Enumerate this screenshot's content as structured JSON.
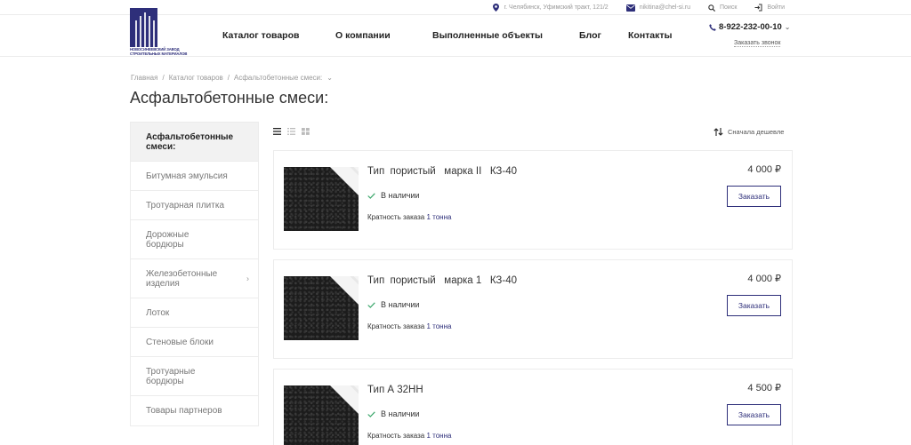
{
  "topbar": {
    "address": "г. Челябинск, Уфимский тракт, 121/2",
    "email": "nikitina@chel-si.ru",
    "search": "Поиск",
    "login": "Войти"
  },
  "logo": {
    "line1": "НОВОСИНЕЕВСКИЙ ЗАВОД",
    "line2": "СТРОИТЕЛЬНЫХ МАТЕРИАЛОВ"
  },
  "nav": [
    "Каталог товаров",
    "О компании",
    "Выполненные объекты",
    "Блог",
    "Контакты"
  ],
  "contact": {
    "phone": "8-922-232-00-10",
    "callback": "Заказать звонок"
  },
  "breadcrumbs": [
    "Главная",
    "Каталог товаров",
    "Асфальтобетонные смеси:"
  ],
  "page_title": "Асфальтобетонные смеси:",
  "sidebar": [
    {
      "label": "Асфальтобетонные смеси:",
      "active": true,
      "has_children": false
    },
    {
      "label": "Битумная эмульсия",
      "active": false,
      "has_children": false
    },
    {
      "label": "Тротуарная плитка",
      "active": false,
      "has_children": false
    },
    {
      "label": "Дорожные бордюры",
      "active": false,
      "has_children": false
    },
    {
      "label": "Железобетонные изделия",
      "active": false,
      "has_children": true
    },
    {
      "label": "Лоток",
      "active": false,
      "has_children": false
    },
    {
      "label": "Стеновые блоки",
      "active": false,
      "has_children": false
    },
    {
      "label": "Тротуарные бордюры",
      "active": false,
      "has_children": false
    },
    {
      "label": "Товары партнеров",
      "active": false,
      "has_children": false
    }
  ],
  "sort_label": "Сначала дешевле",
  "products": [
    {
      "name": "Тип  пористый   марка II   КЗ-40",
      "stock": "В наличии",
      "multiplicity_label": "Кратность заказа",
      "multiplicity_value": "1 тонна",
      "price": "4 000 ₽",
      "order_label": "Заказать"
    },
    {
      "name": "Тип  пористый   марка 1   КЗ-40",
      "stock": "В наличии",
      "multiplicity_label": "Кратность заказа",
      "multiplicity_value": "1 тонна",
      "price": "4 000 ₽",
      "order_label": "Заказать"
    },
    {
      "name": "Тип А 32НН",
      "stock": "В наличии",
      "multiplicity_label": "Кратность заказа",
      "multiplicity_value": "1 тонна",
      "price": "4 500 ₽",
      "order_label": "Заказать"
    }
  ],
  "colors": {
    "brand": "#2e2f7a",
    "stock_check": "#3aa66a",
    "border": "#ececec"
  }
}
